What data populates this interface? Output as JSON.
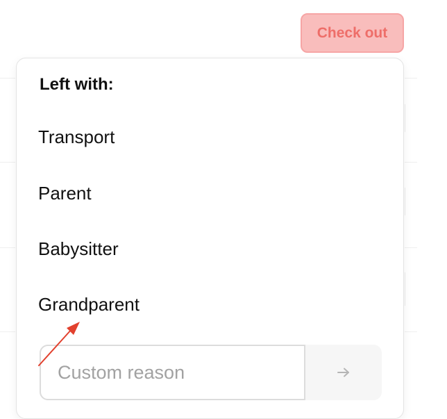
{
  "header": {
    "checkout_label": "Check out"
  },
  "popover": {
    "title": "Left with:",
    "options": [
      {
        "label": "Transport"
      },
      {
        "label": "Parent"
      },
      {
        "label": "Babysitter"
      },
      {
        "label": "Grandparent"
      }
    ],
    "custom": {
      "placeholder": "Custom reason",
      "value": ""
    }
  },
  "icons": {
    "submit": "arrow-right-icon",
    "annotation": "red-pointer-arrow"
  },
  "colors": {
    "checkout_bg": "#f9bdbc",
    "checkout_text": "#ee6e69",
    "annotation": "#e2412e"
  }
}
